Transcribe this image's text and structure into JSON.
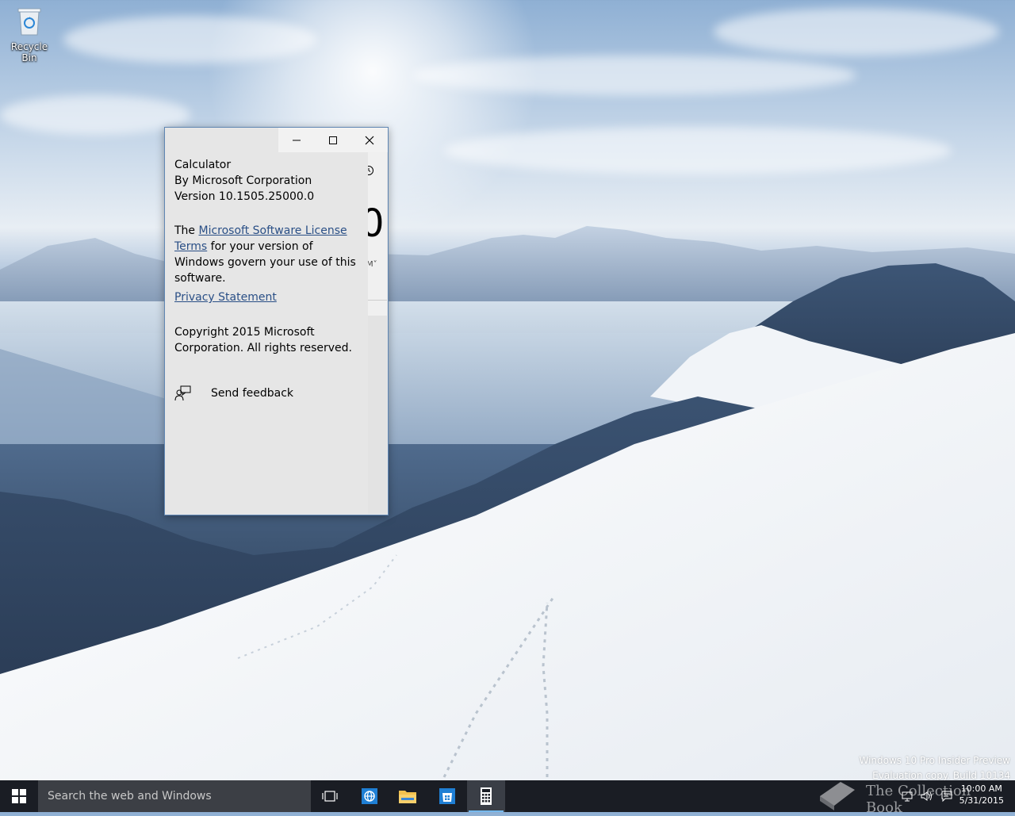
{
  "desktop": {
    "icons": [
      {
        "label": "Recycle Bin"
      }
    ],
    "watermark": {
      "line1": "Windows 10 Pro Insider Preview",
      "line2": "Evaluation copy. Build 10134"
    },
    "brand_watermark": "The Collection Book"
  },
  "about_window": {
    "app_name": "Calculator",
    "publisher": "By Microsoft Corporation",
    "version": "Version 10.1505.25000.0",
    "license_prefix": "The ",
    "license_link": "Microsoft Software License Terms",
    "license_suffix": " for your version of Windows govern your use of this software.",
    "privacy_link": "Privacy Statement",
    "copyright": "Copyright 2015 Microsoft Corporation. All rights reserved.",
    "feedback_label": "Send feedback",
    "controls": [
      "minimize-icon",
      "maximize-icon",
      "close-icon"
    ],
    "underlying_display": "0"
  },
  "taskbar": {
    "search_placeholder": "Search the web and Windows",
    "pinned": [
      {
        "icon": "task-view-icon"
      },
      {
        "icon": "edge-icon"
      },
      {
        "icon": "file-explorer-icon"
      },
      {
        "icon": "store-icon"
      },
      {
        "icon": "calculator-icon",
        "active": true
      }
    ],
    "tray": [
      "network-icon",
      "volume-icon",
      "action-center-icon"
    ],
    "clock": {
      "time": "10:00 AM",
      "date": "5/31/2015"
    }
  },
  "colors": {
    "window_border": "#5f86b3",
    "link": "#2a4f86",
    "taskbar": "#1a1d24",
    "accent": "#76b9ed"
  }
}
